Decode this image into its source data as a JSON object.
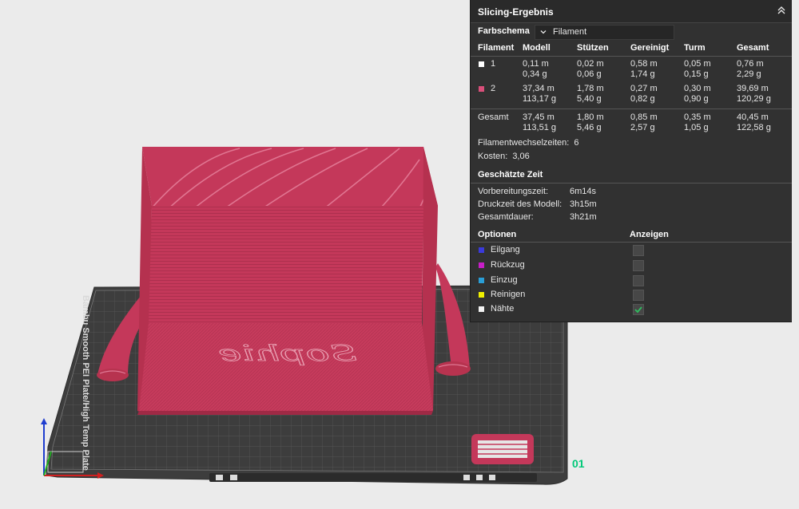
{
  "viewport": {
    "bed_label": "Bambu Smooth PEI Plate/High Temp Plate",
    "model_text": "Sophie",
    "plate_number": "01",
    "colors": {
      "background": "#ebebeb",
      "bed": "#3e3e3e",
      "model": "#c4385a",
      "plate_accent": "#00c878"
    }
  },
  "panel": {
    "title": "Slicing-Ergebnis",
    "color_scheme_label": "Farbschema",
    "color_scheme_value": "Filament",
    "columns": [
      "Filament",
      "Modell",
      "Stützen",
      "Gereinigt",
      "Turm",
      "Gesamt"
    ],
    "filaments": [
      {
        "id": "1",
        "color": "#ffffff",
        "model": [
          "0,11 m",
          "0,34 g"
        ],
        "support": [
          "0,02 m",
          "0,06 g"
        ],
        "flushed": [
          "0,58 m",
          "1,74 g"
        ],
        "tower": [
          "0,05 m",
          "0,15 g"
        ],
        "total": [
          "0,76 m",
          "2,29 g"
        ]
      },
      {
        "id": "2",
        "color": "#d94f7a",
        "model": [
          "37,34 m",
          "113,17 g"
        ],
        "support": [
          "1,78 m",
          "5,40 g"
        ],
        "flushed": [
          "0,27 m",
          "0,82 g"
        ],
        "tower": [
          "0,30 m",
          "0,90 g"
        ],
        "total": [
          "39,69 m",
          "120,29 g"
        ]
      }
    ],
    "totals": {
      "label": "Gesamt",
      "model": [
        "37,45 m",
        "113,51 g"
      ],
      "support": [
        "1,80 m",
        "5,46 g"
      ],
      "flushed": [
        "0,85 m",
        "2,57 g"
      ],
      "tower": [
        "0,35 m",
        "1,05 g"
      ],
      "total": [
        "40,45 m",
        "122,58 g"
      ]
    },
    "filament_changes_label": "Filamentwechselzeiten:",
    "filament_changes_value": "6",
    "cost_label": "Kosten:",
    "cost_value": "3,06",
    "estimated_time_title": "Geschätzte Zeit",
    "times": [
      {
        "label": "Vorbereitungszeit:",
        "value": "6m14s"
      },
      {
        "label": "Druckzeit des Modell:",
        "value": "3h15m"
      },
      {
        "label": "Gesamtdauer:",
        "value": "3h21m"
      }
    ],
    "options_title": "Optionen",
    "show_title": "Anzeigen",
    "options": [
      {
        "label": "Eilgang",
        "color": "#3a3adb",
        "checked": false
      },
      {
        "label": "Rückzug",
        "color": "#c71ec7",
        "checked": false
      },
      {
        "label": "Einzug",
        "color": "#2a9ed6",
        "checked": false
      },
      {
        "label": "Reinigen",
        "color": "#f0f000",
        "checked": false
      },
      {
        "label": "Nähte",
        "color": "#f2f2f2",
        "checked": true
      }
    ]
  }
}
